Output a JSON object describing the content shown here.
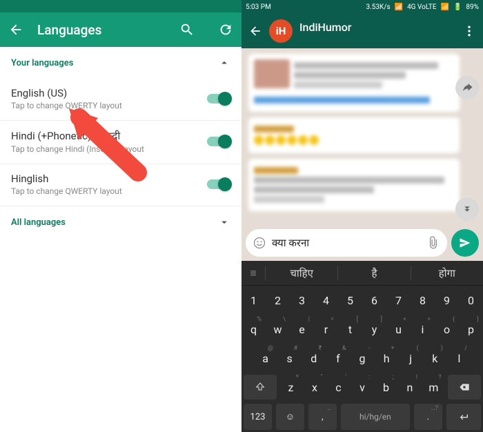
{
  "left": {
    "title": "Languages",
    "your_langs": "Your languages",
    "all_langs": "All languages",
    "items": [
      {
        "name": "English (US)",
        "sub": "Tap to change QWERTY layout"
      },
      {
        "name": "Hindi (+Phonetic) / हिन्दी",
        "sub": "Tap to change Hindi (Inscript) layout"
      },
      {
        "name": "Hinglish",
        "sub": "Tap to change QWERTY layout"
      }
    ]
  },
  "right": {
    "status": {
      "time": "5:03 PM",
      "speed": "3.53K/s",
      "net": "4G VoLTE",
      "batt": "89%"
    },
    "chat_name": "IndiHumor",
    "avatar_text": "iH",
    "input_text": "क्या करना"
  },
  "kbd": {
    "suggestions": [
      "चाहिए",
      "है",
      "होगा"
    ],
    "row_num": [
      "1",
      "2",
      "3",
      "4",
      "5",
      "6",
      "7",
      "8",
      "9",
      "0"
    ],
    "row_q": [
      "q",
      "w",
      "e",
      "r",
      "t",
      "y",
      "u",
      "i",
      "o",
      "p"
    ],
    "row_q_hints": [
      "%",
      "\\",
      "|",
      "=",
      "[",
      "]",
      "<",
      ">",
      "{",
      "}"
    ],
    "row_a": [
      "a",
      "s",
      "d",
      "f",
      "g",
      "h",
      "j",
      "k",
      "l"
    ],
    "row_a_hints": [
      "@",
      "#",
      "₹",
      "&",
      "-",
      "+",
      "(",
      ")",
      "/"
    ],
    "row_z": [
      "z",
      "x",
      "c",
      "v",
      "b",
      "n",
      "m"
    ],
    "row_z_hints": [
      "*",
      "\"",
      "'",
      ":",
      ";",
      "!",
      "?"
    ],
    "sym": "123",
    "space": "hi/hg/en",
    "comma": ",",
    "dot": ".",
    "dot_hint": "…?"
  }
}
